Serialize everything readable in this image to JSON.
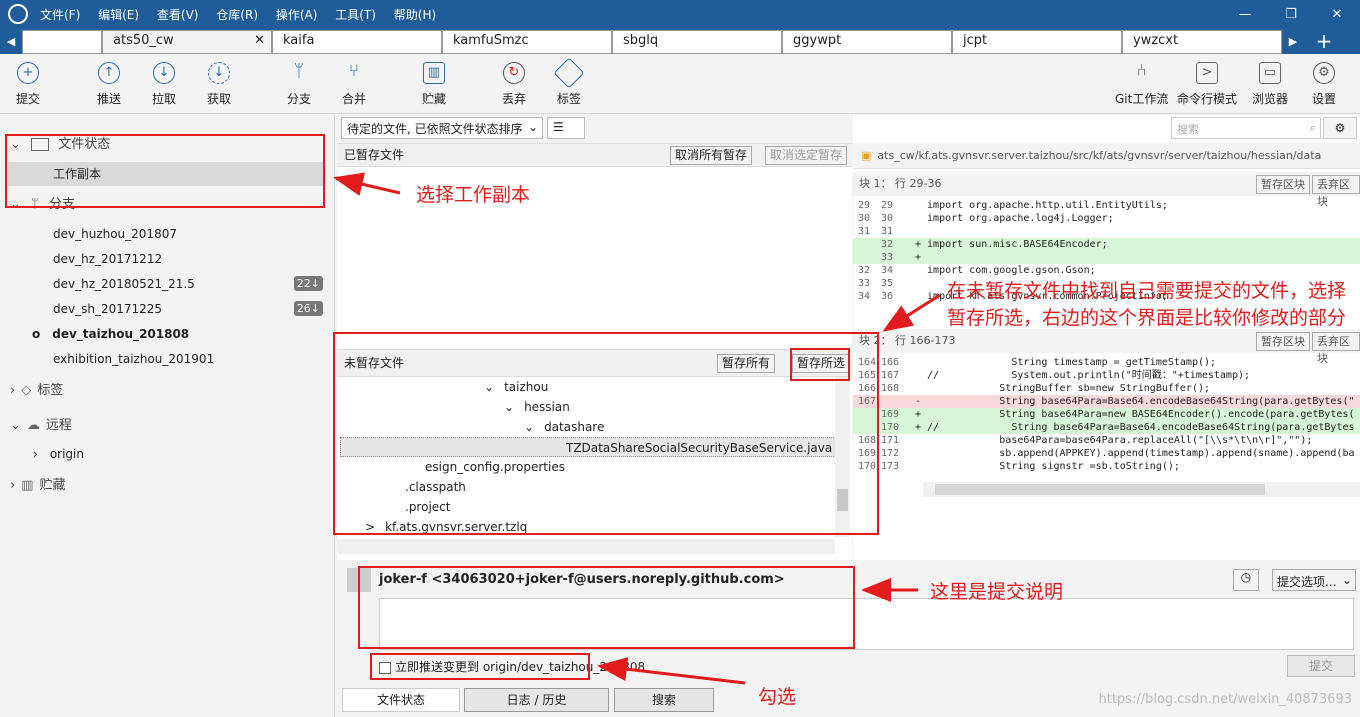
{
  "menu": [
    "文件(F)",
    "编辑(E)",
    "查看(V)",
    "仓库(R)",
    "操作(A)",
    "工具(T)",
    "帮助(H)"
  ],
  "window_buttons": [
    "—",
    "❐",
    "✕"
  ],
  "tabs": [
    "ats50_cw",
    "kaifa",
    "kamfuSmzc",
    "sbglq",
    "ggywpt",
    "jcpt",
    "ywzcxt"
  ],
  "toolbar": {
    "commit": "提交",
    "push": "推送",
    "pull": "拉取",
    "fetch": "获取",
    "branch": "分支",
    "merge": "合并",
    "stash": "贮藏",
    "discard": "丢弃",
    "tag": "标签",
    "gitflow": "Git工作流",
    "terminal": "命令行模式",
    "browser": "浏览器",
    "settings": "设置"
  },
  "sidebar": {
    "file_status": "文件状态",
    "working_copy": "工作副本",
    "branches_header": "分支",
    "branches": [
      {
        "name": "dev_huzhou_201807",
        "badge": ""
      },
      {
        "name": "dev_hz_20171212",
        "badge": ""
      },
      {
        "name": "dev_hz_20180521_21.5",
        "badge": "22↓"
      },
      {
        "name": "dev_sh_20171225",
        "badge": "26↓"
      },
      {
        "name": "dev_taizhou_201808",
        "badge": ""
      },
      {
        "name": "exhibition_taizhou_201901",
        "badge": ""
      }
    ],
    "tags_header": "标签",
    "remotes_header": "远程",
    "remote_origin": "origin",
    "stashes_header": "贮藏"
  },
  "filter": {
    "sort": "待定的文件, 已依照文件状态排序",
    "view": "☰"
  },
  "search": {
    "placeholder": "搜索"
  },
  "staged": {
    "title": "已暂存文件",
    "unstage_all": "取消所有暂存",
    "unstage_selected": "取消选定暂存"
  },
  "unstaged": {
    "title": "未暂存文件",
    "stage_all": "暂存所有",
    "stage_selected": "暂存所选",
    "tree": [
      {
        "label": "taizhou",
        "expander": "⌄"
      },
      {
        "label": "hessian",
        "expander": "⌄"
      },
      {
        "label": "datashare",
        "expander": "⌄"
      },
      {
        "label": "TZDataShareSocialSecurityBaseService.java",
        "expander": ""
      },
      {
        "label": "esign_config.properties",
        "expander": ""
      },
      {
        "label": ".classpath",
        "expander": ""
      },
      {
        "label": ".project",
        "expander": ""
      },
      {
        "label": "kf.ats.gvnsvr.server.tzlq",
        "expander": ">"
      }
    ]
  },
  "diff": {
    "path": "ats_cw/kf.ats.gvnsvr.server.taizhou/src/kf/ats/gvnsvr/server/taizhou/hessian/data",
    "hunk1": {
      "title": "块 1： 行 29-36",
      "stage": "暂存区块",
      "discard": "丢弃区块"
    },
    "hunk2": {
      "title": "块 2： 行 166-173",
      "stage": "暂存区块",
      "discard": "丢弃区块"
    },
    "lines1": [
      {
        "a": "29",
        "b": "29",
        "t": "  import org.apache.http.util.EntityUtils;",
        "k": ""
      },
      {
        "a": "30",
        "b": "30",
        "t": "  import org.apache.log4j.Logger;",
        "k": ""
      },
      {
        "a": "31",
        "b": "31",
        "t": "",
        "k": ""
      },
      {
        "a": "",
        "b": "32",
        "t": "+ import sun.misc.BASE64Encoder;",
        "k": "add"
      },
      {
        "a": "",
        "b": "33",
        "t": "+",
        "k": "add"
      },
      {
        "a": "32",
        "b": "34",
        "t": "  import com.google.gson.Gson;",
        "k": ""
      },
      {
        "a": "33",
        "b": "35",
        "t": "",
        "k": ""
      },
      {
        "a": "34",
        "b": "36",
        "t": "  import kf.ats.gvnsvr.common.ProjectInfo;",
        "k": ""
      }
    ],
    "lines2": [
      {
        "a": "164",
        "b": "166",
        "t": "                String timestamp = getTimeStamp();",
        "k": ""
      },
      {
        "a": "165",
        "b": "167",
        "t": "  //            System.out.println(\"时间戳：\"+timestamp);",
        "k": ""
      },
      {
        "a": "166",
        "b": "168",
        "t": "              StringBuffer sb=new StringBuffer();",
        "k": ""
      },
      {
        "a": "167",
        "b": "",
        "t": "-             String base64Para=Base64.encodeBase64String(para.getBytes(\"",
        "k": "del"
      },
      {
        "a": "",
        "b": "169",
        "t": "+             String base64Para=new BASE64Encoder().encode(para.getBytes(",
        "k": "add"
      },
      {
        "a": "",
        "b": "170",
        "t": "+ //            String base64Para=Base64.encodeBase64String(para.getBytes",
        "k": "add"
      },
      {
        "a": "168",
        "b": "171",
        "t": "              base64Para=base64Para.replaceAll(\"[\\\\s*\\t\\n\\r]\",\"\");",
        "k": ""
      },
      {
        "a": "169",
        "b": "172",
        "t": "              sb.append(APPKEY).append(timestamp).append(sname).append(ba",
        "k": ""
      },
      {
        "a": "170",
        "b": "173",
        "t": "              String signstr =sb.toString();",
        "k": ""
      }
    ]
  },
  "commit": {
    "author": "joker-f <34063020+joker-f@users.noreply.github.com>",
    "options": "提交选项...",
    "push_now": "立即推送变更到 origin/dev_taizhou_201808",
    "commit_button": "提交"
  },
  "bottom_tabs": [
    "文件状态",
    "日志 / 历史",
    "搜索"
  ],
  "annotations": {
    "a1": "选择工作副本",
    "a2": "在未暂存文件中找到自己需要提交的文件，选择暂存所选，右边的这个界面是比较你修改的部分",
    "a3": "这里是提交说明",
    "a4": "勾选"
  },
  "watermark": "https://blog.csdn.net/weixin_40873693",
  "colors": {
    "accent": "#1f5c99",
    "annotation": "#e21c1c",
    "added": "#d7f5d7",
    "removed": "#f9d9dc"
  }
}
